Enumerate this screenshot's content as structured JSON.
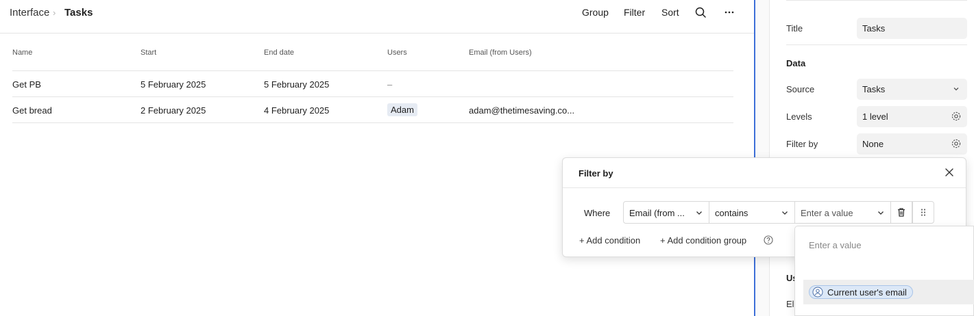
{
  "breadcrumb": {
    "root": "Interface",
    "separator": "›",
    "current": "Tasks"
  },
  "toolbar": {
    "group": "Group",
    "filter": "Filter",
    "sort": "Sort",
    "search_icon": "search-icon",
    "more_icon": "more-icon"
  },
  "table": {
    "columns": [
      "Name",
      "Start",
      "End date",
      "Users",
      "Email (from Users)"
    ],
    "rows": [
      {
        "name": "Get PB",
        "start": "5 February 2025",
        "end": "5 February 2025",
        "users": "–",
        "email": ""
      },
      {
        "name": "Get bread",
        "start": "2 February 2025",
        "end": "4 February 2025",
        "users": "Adam",
        "email": "adam@thetimesaving.co..."
      }
    ]
  },
  "panel": {
    "title_label": "Title",
    "title_value": "Tasks",
    "data_heading": "Data",
    "source_label": "Source",
    "source_value": "Tasks",
    "levels_label": "Levels",
    "levels_value": "1 level",
    "filter_label": "Filter by",
    "filter_value": "None",
    "partial_heading": "Us",
    "partial_label": "El"
  },
  "filter_popup": {
    "title": "Filter by",
    "where": "Where",
    "field": "Email (from ...",
    "operator": "contains",
    "value_placeholder": "Enter a value",
    "add_condition": "+ Add condition",
    "add_group": "+ Add condition group"
  },
  "value_dropdown": {
    "placeholder": "Enter a value",
    "option": "Current user's email"
  },
  "colors": {
    "accent": "#3d6fd8",
    "chip": "#dce8f7",
    "user_chip": "#e6ebf3"
  }
}
